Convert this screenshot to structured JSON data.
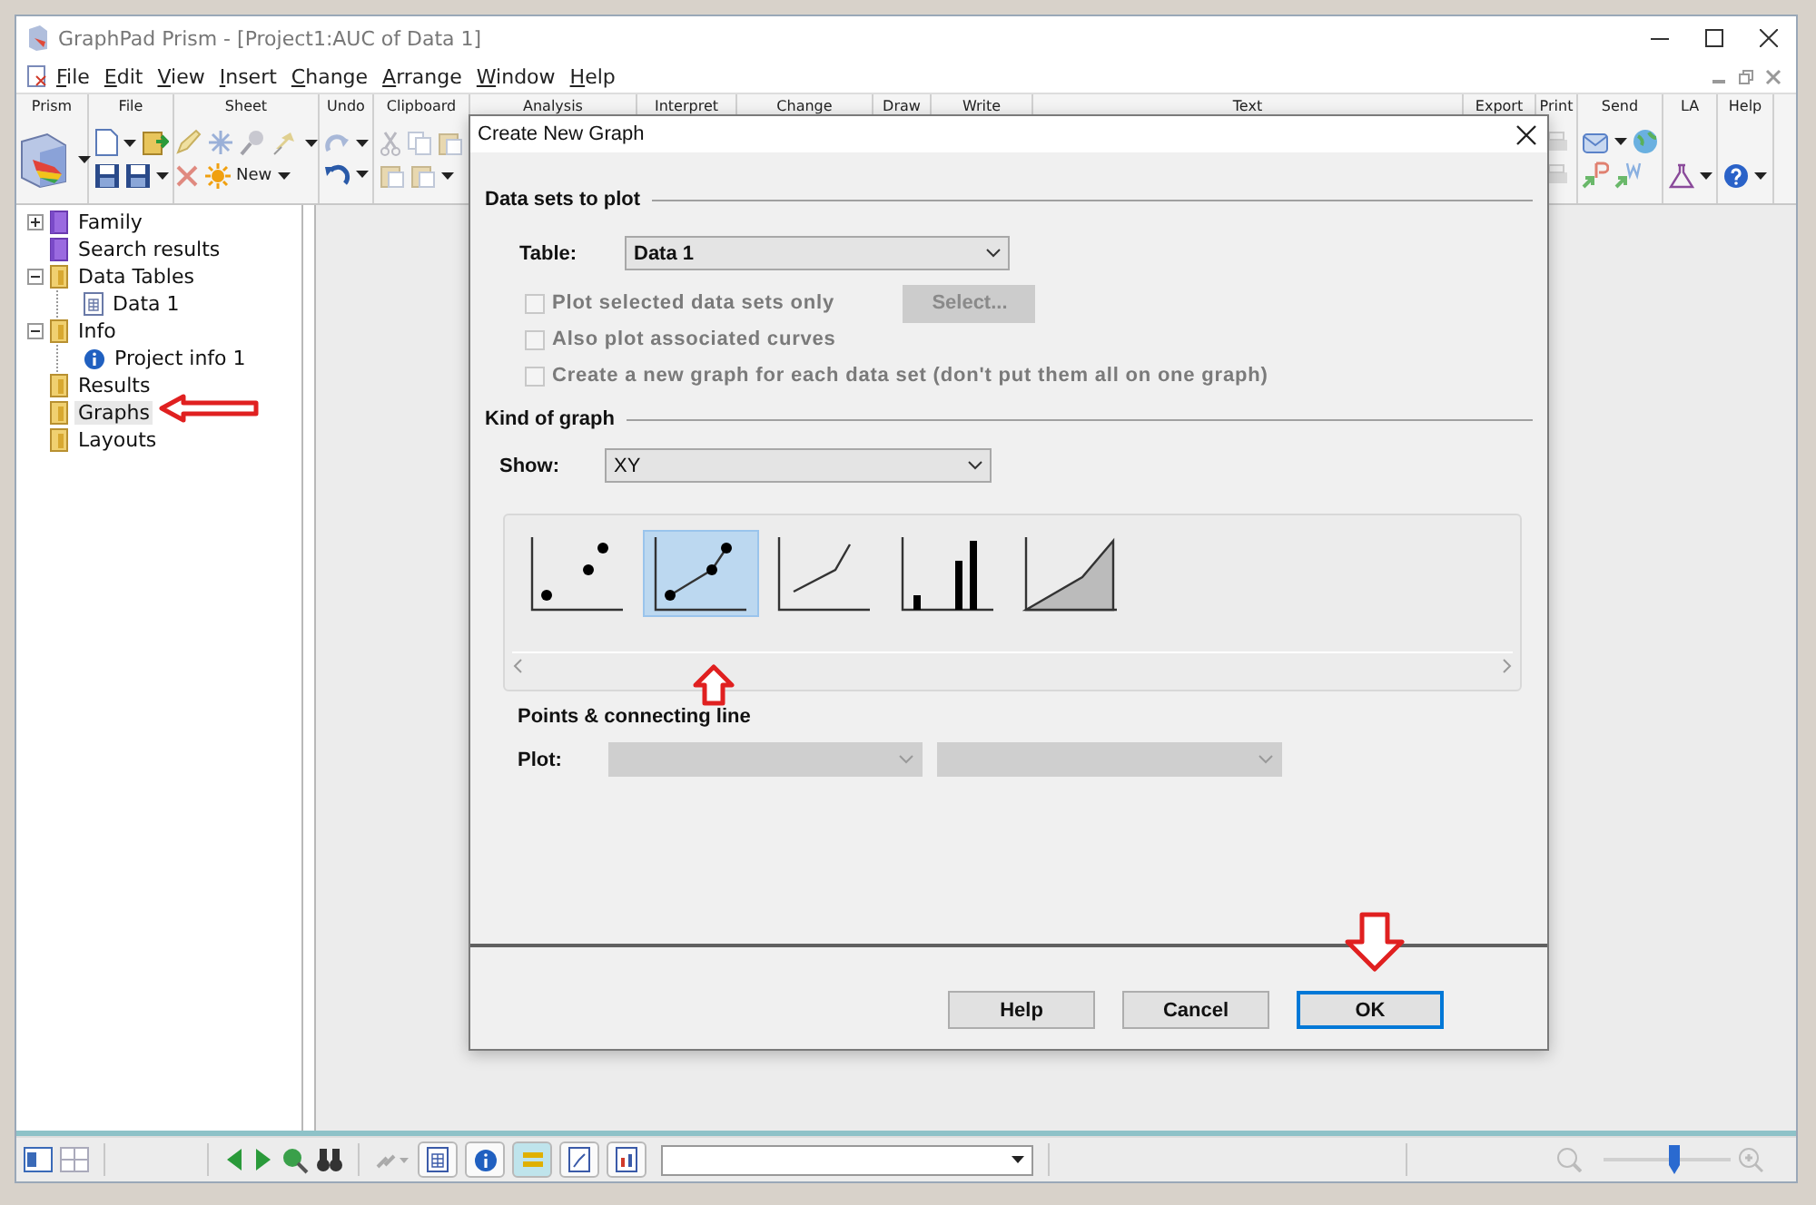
{
  "window": {
    "title": "GraphPad Prism - [Project1:AUC of Data 1]"
  },
  "menu": [
    "File",
    "Edit",
    "View",
    "Insert",
    "Change",
    "Arrange",
    "Window",
    "Help"
  ],
  "ribbon": {
    "groups": [
      "Prism",
      "File",
      "Sheet",
      "Undo",
      "Clipboard",
      "Analysis",
      "Interpret",
      "Change",
      "Draw",
      "Write",
      "Text",
      "Export",
      "Print",
      "Send",
      "LA",
      "Help"
    ],
    "new_label": "New"
  },
  "tree": [
    {
      "label": "Family",
      "kind": "family",
      "expanded": false,
      "selected": false
    },
    {
      "label": "Search results",
      "kind": "family",
      "selected": false
    },
    {
      "label": "Data Tables",
      "kind": "folder",
      "expanded": true,
      "selected": false,
      "children": [
        {
          "label": "Data 1",
          "kind": "table",
          "selected": false
        }
      ]
    },
    {
      "label": "Info",
      "kind": "folder",
      "expanded": true,
      "selected": false,
      "children": [
        {
          "label": "Project info 1",
          "kind": "info",
          "selected": false
        }
      ]
    },
    {
      "label": "Results",
      "kind": "folder",
      "selected": false
    },
    {
      "label": "Graphs",
      "kind": "folder",
      "selected": true
    },
    {
      "label": "Layouts",
      "kind": "folder",
      "selected": false
    }
  ],
  "dialog": {
    "title": "Create New Graph",
    "data_sets": {
      "heading": "Data sets to plot",
      "table_label": "Table:",
      "table_value": "Data 1",
      "options": [
        {
          "label": "Plot selected data sets only",
          "checked": false,
          "disabled": true
        },
        {
          "label": "Also plot associated curves",
          "checked": false,
          "disabled": true
        },
        {
          "label": "Create a new graph for each data set (don't put them all on one graph)",
          "checked": false,
          "disabled": true
        }
      ],
      "select_button": {
        "label": "Select...",
        "disabled": true
      }
    },
    "kind_of_graph": {
      "heading": "Kind of graph",
      "show_label": "Show:",
      "show_value": "XY",
      "types": [
        {
          "kind": "scatter",
          "selected": false
        },
        {
          "kind": "points-line",
          "selected": true
        },
        {
          "kind": "line",
          "selected": false
        },
        {
          "kind": "bar",
          "selected": false
        },
        {
          "kind": "area",
          "selected": false
        }
      ],
      "type_name": "Points & connecting line",
      "plot_label": "Plot:"
    },
    "buttons": [
      {
        "label": "Help",
        "default": false
      },
      {
        "label": "Cancel",
        "default": false
      },
      {
        "label": "OK",
        "default": true
      }
    ]
  },
  "status_bar": {
    "zoom": {
      "level": 0.55
    }
  }
}
